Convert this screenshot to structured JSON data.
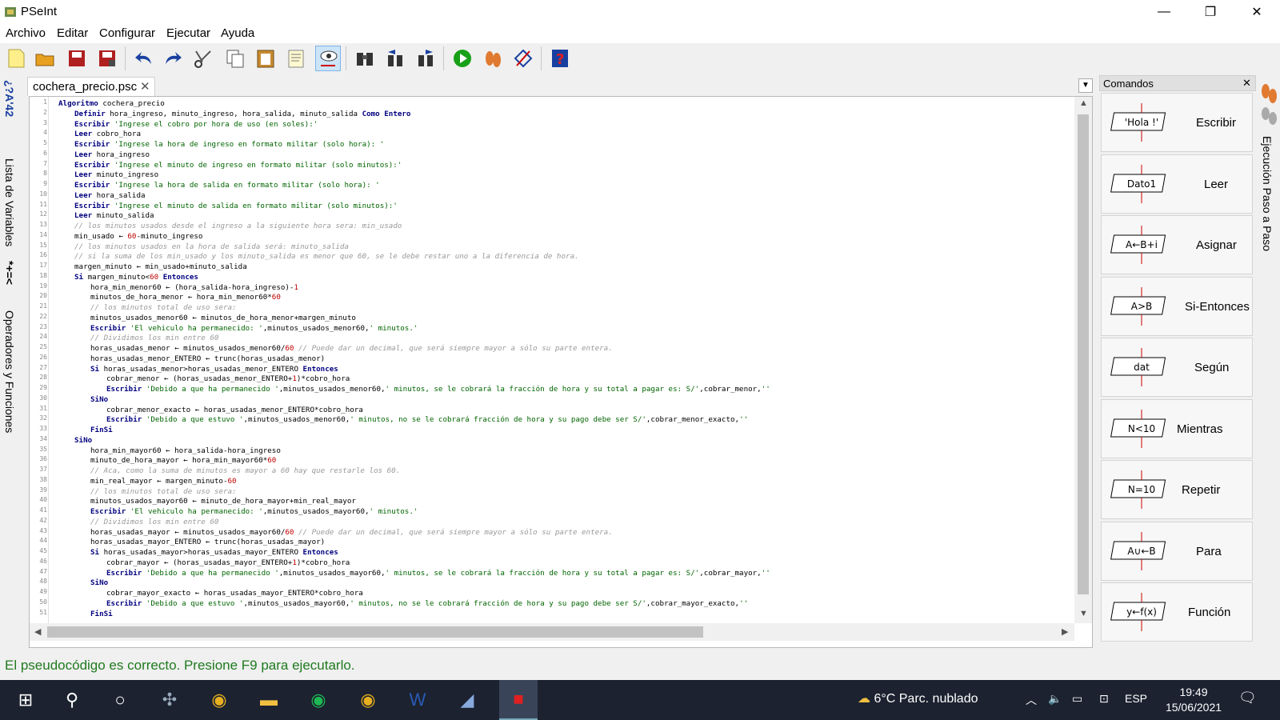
{
  "window": {
    "title": "PSeInt",
    "minimize": "—",
    "restore": "❐",
    "close": "✕"
  },
  "menu": [
    "Archivo",
    "Editar",
    "Configurar",
    "Ejecutar",
    "Ayuda"
  ],
  "toolbar_icons": [
    "new-file-icon",
    "open-folder-icon",
    "save-icon",
    "save-as-icon",
    "undo-icon",
    "redo-icon",
    "cut-icon",
    "copy-icon",
    "paste-icon",
    "comment-icon",
    "inspect-icon",
    "search-icon",
    "search-prev-icon",
    "search-next-icon",
    "run-icon",
    "step-icon",
    "flowchart-icon",
    "help-icon"
  ],
  "left_panel": {
    "variables_label": "Lista de Variables",
    "operators_label": "Operadores y Funciones",
    "variables_icon": "*+=<",
    "operators_icon": "¿?A'42"
  },
  "tab": {
    "label": "cochera_precio.psc",
    "close": "✕"
  },
  "code_lines": [
    [
      1,
      0,
      "Algoritmo cochera_precio"
    ],
    [
      2,
      1,
      "Definir hora_ingreso, minuto_ingreso, hora_salida, minuto_salida Como Entero"
    ],
    [
      3,
      1,
      "Escribir 'Ingrese el cobro por hora de uso (en soles):'"
    ],
    [
      4,
      1,
      "Leer cobro_hora"
    ],
    [
      5,
      1,
      "Escribir 'Ingrese la hora de ingreso en formato militar (solo hora): '"
    ],
    [
      6,
      1,
      "Leer hora_ingreso"
    ],
    [
      7,
      1,
      "Escribir 'Ingrese el minuto de ingreso en formato militar (solo minutos):'"
    ],
    [
      8,
      1,
      "Leer minuto_ingreso"
    ],
    [
      9,
      1,
      "Escribir 'Ingrese la hora de salida en formato militar (solo hora): '"
    ],
    [
      10,
      1,
      "Leer hora_salida"
    ],
    [
      11,
      1,
      "Escribir 'Ingrese el minuto de salida en formato militar (solo minutos):'"
    ],
    [
      12,
      1,
      "Leer minuto_salida"
    ],
    [
      13,
      1,
      "// los minutos usados desde el ingreso a la siguiente hora sera: min_usado"
    ],
    [
      14,
      1,
      "min_usado ← 60-minuto_ingreso"
    ],
    [
      15,
      1,
      "// los minutos usados en la hora de salida será: minuto_salida"
    ],
    [
      16,
      1,
      "// si la suma de los min_usado y los minuto_salida es menor que 60, se le debe restar uno a la diferencia de hora."
    ],
    [
      17,
      1,
      "margen_minuto ← min_usado+minuto_salida"
    ],
    [
      18,
      1,
      "Si margen_minuto<60 Entonces"
    ],
    [
      19,
      2,
      "hora_min_menor60 ← (hora_salida-hora_ingreso)-1"
    ],
    [
      20,
      2,
      "minutos_de_hora_menor ← hora_min_menor60*60"
    ],
    [
      21,
      2,
      "// los minutos total de uso sera:"
    ],
    [
      22,
      2,
      "minutos_usados_menor60 ← minutos_de_hora_menor+margen_minuto"
    ],
    [
      23,
      2,
      "Escribir 'El vehiculo ha permanecido: ',minutos_usados_menor60,' minutos.'"
    ],
    [
      24,
      2,
      "// Dividimos los min entre 60"
    ],
    [
      25,
      2,
      "horas_usadas_menor ← minutos_usados_menor60/60 // Puede dar un decimal, que será siempre mayor a sólo su parte entera."
    ],
    [
      26,
      2,
      "horas_usadas_menor_ENTERO ← trunc(horas_usadas_menor)"
    ],
    [
      27,
      2,
      "Si horas_usadas_menor>horas_usadas_menor_ENTERO Entonces"
    ],
    [
      28,
      3,
      "cobrar_menor ← (horas_usadas_menor_ENTERO+1)*cobro_hora"
    ],
    [
      29,
      3,
      "Escribir 'Debido a que ha permanecido ',minutos_usados_menor60,' minutos, se le cobrará la fracción de hora y su total a pagar es: S/',cobrar_menor,''"
    ],
    [
      30,
      2,
      "SiNo"
    ],
    [
      31,
      3,
      "cobrar_menor_exacto ← horas_usadas_menor_ENTERO*cobro_hora"
    ],
    [
      32,
      3,
      "Escribir 'Debido a que estuvo ',minutos_usados_menor60,' minutos, no se le cobrará fracción de hora y su pago debe ser S/',cobrar_menor_exacto,''"
    ],
    [
      33,
      2,
      "FinSi"
    ],
    [
      34,
      1,
      "SiNo"
    ],
    [
      35,
      2,
      "hora_min_mayor60 ← hora_salida-hora_ingreso"
    ],
    [
      36,
      2,
      "minuto_de_hora_mayor ← hora_min_mayor60*60"
    ],
    [
      37,
      2,
      "// Aca, como la suma de minutos es mayor a 60 hay que restarle los 60."
    ],
    [
      38,
      2,
      "min_real_mayor ← margen_minuto-60"
    ],
    [
      39,
      2,
      "// los minutos total de uso sera:"
    ],
    [
      40,
      2,
      "minutos_usados_mayor60 ← minuto_de_hora_mayor+min_real_mayor"
    ],
    [
      41,
      2,
      "Escribir 'El vehiculo ha permanecido: ',minutos_usados_mayor60,' minutos.'"
    ],
    [
      42,
      2,
      "// Dividimos los min entre 60"
    ],
    [
      43,
      2,
      "horas_usadas_mayor ← minutos_usados_mayor60/60 // Puede dar un decimal, que será siempre mayor a sólo su parte entera."
    ],
    [
      44,
      2,
      "horas_usadas_mayor_ENTERO ← trunc(horas_usadas_mayor)"
    ],
    [
      45,
      2,
      "Si horas_usadas_mayor>horas_usadas_mayor_ENTERO Entonces"
    ],
    [
      46,
      3,
      "cobrar_mayor ← (horas_usadas_mayor_ENTERO+1)*cobro_hora"
    ],
    [
      47,
      3,
      "Escribir 'Debido a que ha permanecido ',minutos_usados_mayor60,' minutos, se le cobrará la fracción de hora y su total a pagar es: S/',cobrar_mayor,''"
    ],
    [
      48,
      2,
      "SiNo"
    ],
    [
      49,
      3,
      "cobrar_mayor_exacto ← horas_usadas_mayor_ENTERO*cobro_hora"
    ],
    [
      50,
      3,
      "Escribir 'Debido a que estuvo ',minutos_usados_mayor60,' minutos, no se le cobrará fracción de hora y su pago debe ser S/',cobrar_mayor_exacto,''"
    ],
    [
      51,
      2,
      "FinSi"
    ]
  ],
  "keywords": [
    "Algoritmo",
    "Definir",
    "Como",
    "Entero",
    "Escribir",
    "Leer",
    "Si",
    "Entonces",
    "SiNo",
    "FinSi"
  ],
  "commands": {
    "title": "Comandos",
    "close": "✕",
    "items": [
      {
        "label": "Escribir",
        "glyph": "'Hola !'"
      },
      {
        "label": "Leer",
        "glyph": "Dato1"
      },
      {
        "label": "Asignar",
        "glyph": "A←B+i"
      },
      {
        "label": "Si-Entonces",
        "glyph": "A>B"
      },
      {
        "label": "Según",
        "glyph": "dat"
      },
      {
        "label": "Mientras",
        "glyph": "N<10"
      },
      {
        "label": "Repetir",
        "glyph": "N=10"
      },
      {
        "label": "Para",
        "glyph": "A∪←B"
      },
      {
        "label": "Función",
        "glyph": "y←f(x)"
      }
    ]
  },
  "right_panel": {
    "label": "Ejecución Paso a Paso"
  },
  "status": "El pseudocódigo es correcto. Presione F9 para ejecutarlo.",
  "taskbar": {
    "apps": [
      "windows-start-icon",
      "search-icon",
      "cortana-icon",
      "pseint-icon",
      "chrome-icon",
      "file-explorer-icon",
      "spotify-icon",
      "chrome-icon",
      "word-icon",
      "notepad-icon",
      "pseint-active-icon"
    ],
    "weather": "6°C  Parc. nublado",
    "lang": "ESP",
    "time": "19:49",
    "date": "15/06/2021",
    "colors": {
      "bg": "#1c2230",
      "active": "#3a4458"
    }
  }
}
